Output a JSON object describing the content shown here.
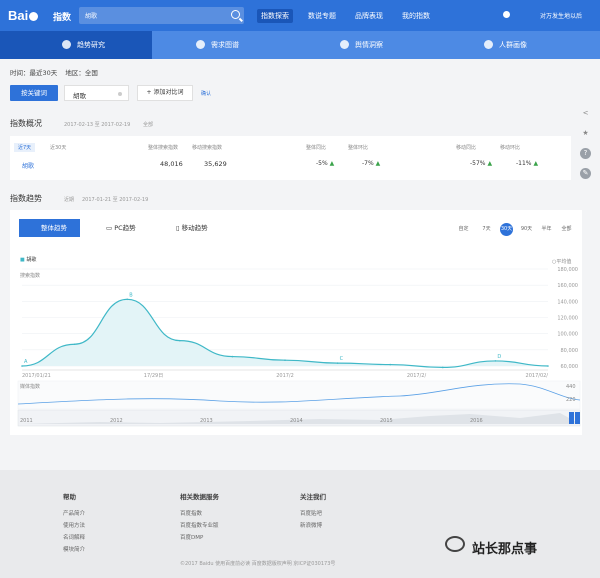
{
  "header": {
    "logo": "Bai",
    "logo_suffix": "指数",
    "search_value": "胡歌",
    "nav": [
      "指数探索",
      "数说专题",
      "品牌表现",
      "我的指数"
    ],
    "user": "对万发生地以后"
  },
  "subnav": [
    "趋势研究",
    "需求图谱",
    "舆情洞察",
    "人群画像"
  ],
  "filters": {
    "time": "时间：最近30天",
    "region": "地区：全国",
    "keyword_btn": "按关键词",
    "keyword": "胡歌",
    "add_compare": "+ 添加对比词",
    "confirm": "确认"
  },
  "overview": {
    "title": "指数概况",
    "date": "2017-02-13 至 2017-02-19",
    "period_label": "全部",
    "tabs": [
      "近7天",
      "近30天"
    ],
    "col_overall": "整体搜索指数",
    "col_mobile": "移动搜索指数",
    "col_overall_yoy": "整体同比",
    "col_overall_hb": "整体环比",
    "col_mobile_yoy": "移动同比",
    "col_mobile_hb": "移动环比",
    "keyword": "胡歌",
    "overall_val": "48,016",
    "mobile_val": "35,629",
    "overall_yoy": "-5%",
    "overall_hb": "-7%",
    "mobile_yoy": "-57%",
    "mobile_hb": "-11%"
  },
  "trend": {
    "title": "指数趋势",
    "date_label": "近期",
    "date": "2017-01-21 至 2017-02-19",
    "tabs": [
      "整体趋势",
      "PC趋势",
      "移动趋势"
    ],
    "ranges": [
      "自定",
      "7天",
      "30天",
      "90天",
      "半年",
      "全部"
    ],
    "active_range": 2,
    "legend": "胡歌",
    "avg_label": "平均值",
    "y_label": "搜索指数",
    "mini_label": "媒体指数",
    "mini_ticks": [
      "440",
      "220"
    ],
    "year_ticks": [
      "2011",
      "2012",
      "2013",
      "2014",
      "2015",
      "2016"
    ],
    "markers": [
      "A",
      "B",
      "C",
      "D"
    ]
  },
  "chart_data": {
    "type": "area",
    "x": [
      "2017/01/21",
      "2017/01/24",
      "2017/01/27",
      "2017/01/30",
      "2017/02/02",
      "2017/02/05",
      "2017/02/08",
      "2017/02/11",
      "2017/02/14",
      "2017/02/17",
      "2017/02/19"
    ],
    "x_ticks": [
      "2017/01/21",
      "17/29日",
      "2017/2",
      "2017/2/",
      "2017/02/"
    ],
    "series": [
      {
        "name": "胡歌",
        "values": [
          60000,
          90000,
          152000,
          95000,
          73000,
          68000,
          64000,
          62000,
          58000,
          67000,
          60000
        ]
      }
    ],
    "ylabel": "搜索指数",
    "y_ticks": [
      "180,000",
      "160,000",
      "140,000",
      "120,000",
      "100,000",
      "80,000",
      "60,000"
    ],
    "ylim": [
      60000,
      180000
    ]
  },
  "footer": {
    "col1_title": "帮助",
    "col1": [
      "产品简介",
      "使用方法",
      "名词解释",
      "模块简介"
    ],
    "col2_title": "相关数据服务",
    "col2": [
      "百度指数",
      "百度指数专业版",
      "百度DMP"
    ],
    "col3_title": "关注我们",
    "col3": [
      "百度贴吧",
      "新浪微博"
    ],
    "copyright": "©2017 Baidu 使用百度前必读 百度数据版权声明 京ICP证030173号",
    "watermark": "站长那点事"
  }
}
